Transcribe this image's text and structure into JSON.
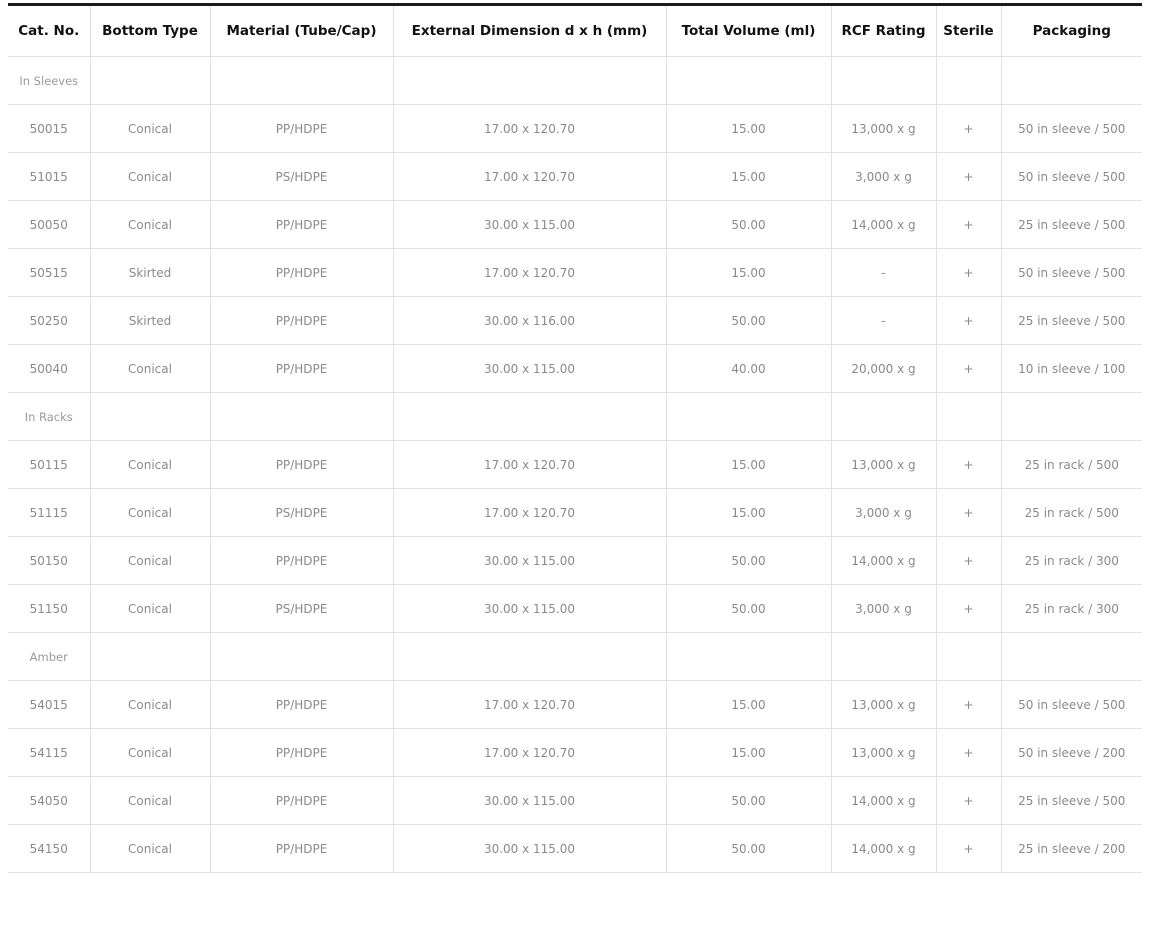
{
  "table": {
    "columns": [
      "Cat. No.",
      "Bottom Type",
      "Material (Tube/Cap)",
      "External Dimension d x h (mm)",
      "Total Volume (ml)",
      "RCF Rating",
      "Sterile",
      "Packaging"
    ],
    "groups": [
      {
        "name": "In Sleeves",
        "rows": [
          [
            "50015",
            "Conical",
            "PP/HDPE",
            "17.00 x 120.70",
            "15.00",
            "13,000 x g",
            "+",
            "50 in sleeve / 500"
          ],
          [
            "51015",
            "Conical",
            "PS/HDPE",
            "17.00 x 120.70",
            "15.00",
            "3,000 x g",
            "+",
            "50 in sleeve / 500"
          ],
          [
            "50050",
            "Conical",
            "PP/HDPE",
            "30.00 x 115.00",
            "50.00",
            "14,000 x g",
            "+",
            "25 in sleeve / 500"
          ],
          [
            "50515",
            "Skirted",
            "PP/HDPE",
            "17.00 x 120.70",
            "15.00",
            "-",
            "+",
            "50 in sleeve / 500"
          ],
          [
            "50250",
            "Skirted",
            "PP/HDPE",
            "30.00 x 116.00",
            "50.00",
            "-",
            "+",
            "25 in sleeve / 500"
          ],
          [
            "50040",
            "Conical",
            "PP/HDPE",
            "30.00 x 115.00",
            "40.00",
            "20,000 x g",
            "+",
            "10 in sleeve / 100"
          ]
        ]
      },
      {
        "name": "In Racks",
        "rows": [
          [
            "50115",
            "Conical",
            "PP/HDPE",
            "17.00 x 120.70",
            "15.00",
            "13,000 x g",
            "+",
            "25 in rack / 500"
          ],
          [
            "51115",
            "Conical",
            "PS/HDPE",
            "17.00 x 120.70",
            "15.00",
            "3,000 x g",
            "+",
            "25 in rack / 500"
          ],
          [
            "50150",
            "Conical",
            "PP/HDPE",
            "30.00 x 115.00",
            "50.00",
            "14,000 x g",
            "+",
            "25 in rack / 300"
          ],
          [
            "51150",
            "Conical",
            "PS/HDPE",
            "30.00 x 115.00",
            "50.00",
            "3,000 x g",
            "+",
            "25 in rack / 300"
          ]
        ]
      },
      {
        "name": "Amber",
        "rows": [
          [
            "54015",
            "Conical",
            "PP/HDPE",
            "17.00 x 120.70",
            "15.00",
            "13,000 x g",
            "+",
            "50 in sleeve / 500"
          ],
          [
            "54115",
            "Conical",
            "PP/HDPE",
            "17.00 x 120.70",
            "15.00",
            "13,000 x g",
            "+",
            "50 in sleeve / 200"
          ],
          [
            "54050",
            "Conical",
            "PP/HDPE",
            "30.00 x 115.00",
            "50.00",
            "14,000 x g",
            "+",
            "25 in sleeve / 500"
          ],
          [
            "54150",
            "Conical",
            "PP/HDPE",
            "30.00 x 115.00",
            "50.00",
            "14,000 x g",
            "+",
            "25 in sleeve / 200"
          ]
        ]
      }
    ]
  }
}
